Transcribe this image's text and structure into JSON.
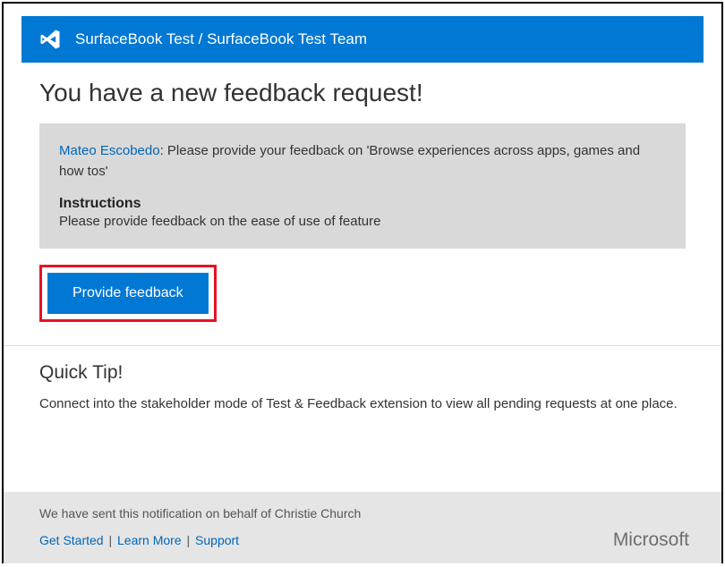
{
  "header": {
    "breadcrumb": "SurfaceBook Test / SurfaceBook Test Team"
  },
  "main": {
    "heading": "You have a new feedback request!",
    "requester_name": "Mateo Escobedo",
    "requester_suffix": ": ",
    "request_text": "Please provide your feedback on 'Browse experiences across  apps, games and how tos'",
    "instructions_label": "Instructions",
    "instructions_text": "Please provide feedback on the ease of use of feature",
    "cta_label": "Provide feedback"
  },
  "tip": {
    "heading": "Quick Tip!",
    "text": "Connect into the stakeholder mode of Test & Feedback extension to view all pending requests at one place."
  },
  "footer": {
    "notice": "We have sent this notification on behalf of  Christie Church",
    "links": {
      "get_started": "Get Started",
      "learn_more": "Learn More",
      "support": "Support"
    },
    "brand": "Microsoft"
  }
}
